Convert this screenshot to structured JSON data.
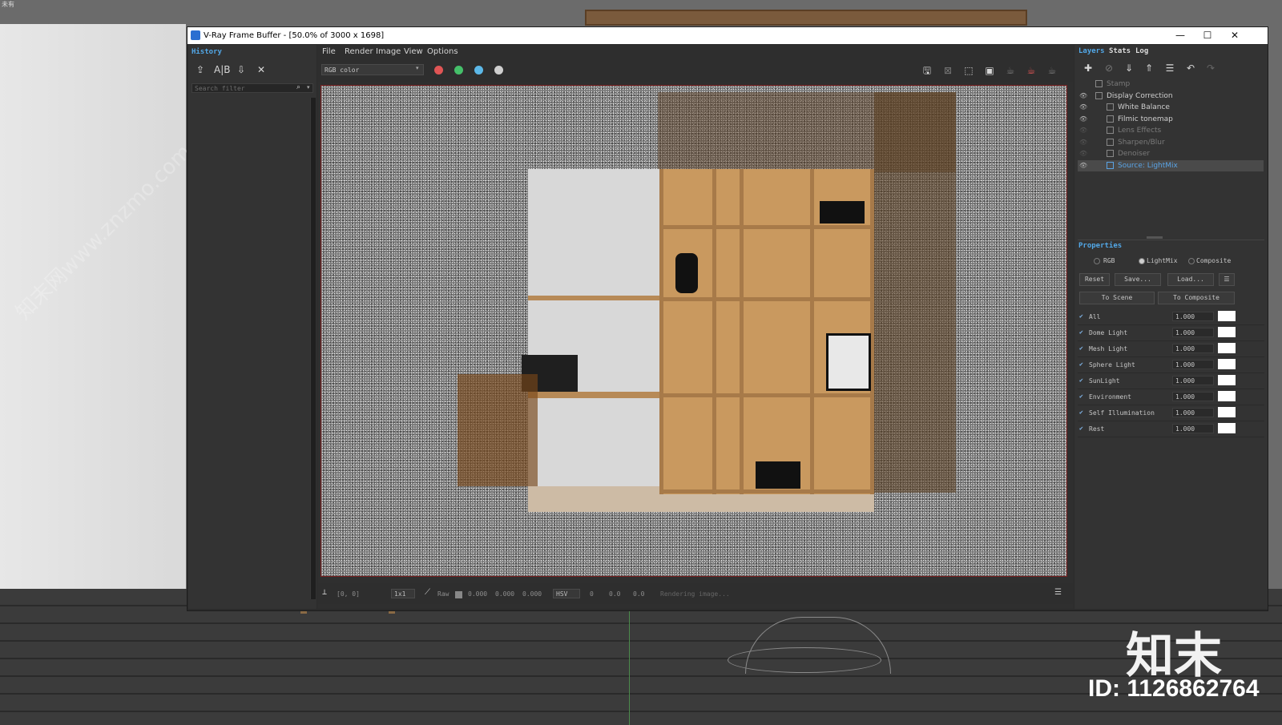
{
  "desktop": {
    "top_label": "未有",
    "watermark_logo": "知末",
    "watermark_id": "ID: 1126862764",
    "watermark_diag": "知末网www.znzmo.com"
  },
  "window": {
    "title": "V-Ray Frame Buffer - [50.0% of 3000 x 1698]",
    "minimize": "—",
    "maximize": "☐",
    "close": "✕"
  },
  "history": {
    "title": "History",
    "search_placeholder": "Search filter"
  },
  "menu": [
    "File",
    "Render",
    "Image",
    "View",
    "Options"
  ],
  "toolbar": {
    "channel": "RGB color",
    "red_color": "#e05555",
    "green_color": "#45c06a",
    "blue_color": "#5cb8e8"
  },
  "statusbar": {
    "coords": "[0, 0]",
    "zoom": "1x1",
    "raw_label": "Raw",
    "r": "0.000",
    "g": "0.000",
    "b": "0.000",
    "mode": "HSV",
    "h": "0",
    "s": "0.0",
    "v": "0.0",
    "status": "Rendering image..."
  },
  "right": {
    "tabs": [
      "Layers",
      "Stats",
      "Log"
    ],
    "layers": [
      {
        "name": "Stamp",
        "dim": true,
        "indent": 0
      },
      {
        "name": "Display Correction",
        "dim": false,
        "indent": 0
      },
      {
        "name": "White Balance",
        "dim": false,
        "indent": 1
      },
      {
        "name": "Filmic tonemap",
        "dim": false,
        "indent": 1
      },
      {
        "name": "Lens Effects",
        "dim": true,
        "indent": 1
      },
      {
        "name": "Sharpen/Blur",
        "dim": true,
        "indent": 1
      },
      {
        "name": "Denoiser",
        "dim": true,
        "indent": 1
      },
      {
        "name": "Source: LightMix",
        "dim": false,
        "indent": 1,
        "selected": true
      }
    ],
    "properties_title": "Properties",
    "modes": [
      "RGB",
      "LightMix",
      "Composite"
    ],
    "selected_mode": "LightMix",
    "buttons": {
      "reset": "Reset",
      "save": "Save...",
      "load": "Load...",
      "to_scene": "To Scene",
      "to_composite": "To Composite"
    },
    "lights": [
      {
        "name": "All",
        "value": "1.000"
      },
      {
        "name": "Dome Light",
        "value": "1.000"
      },
      {
        "name": "Mesh Light",
        "value": "1.000"
      },
      {
        "name": "Sphere Light",
        "value": "1.000"
      },
      {
        "name": "SunLight",
        "value": "1.000"
      },
      {
        "name": "Environment",
        "value": "1.000"
      },
      {
        "name": "Self Illumination",
        "value": "1.000"
      },
      {
        "name": "Rest",
        "value": "1.000"
      }
    ]
  }
}
